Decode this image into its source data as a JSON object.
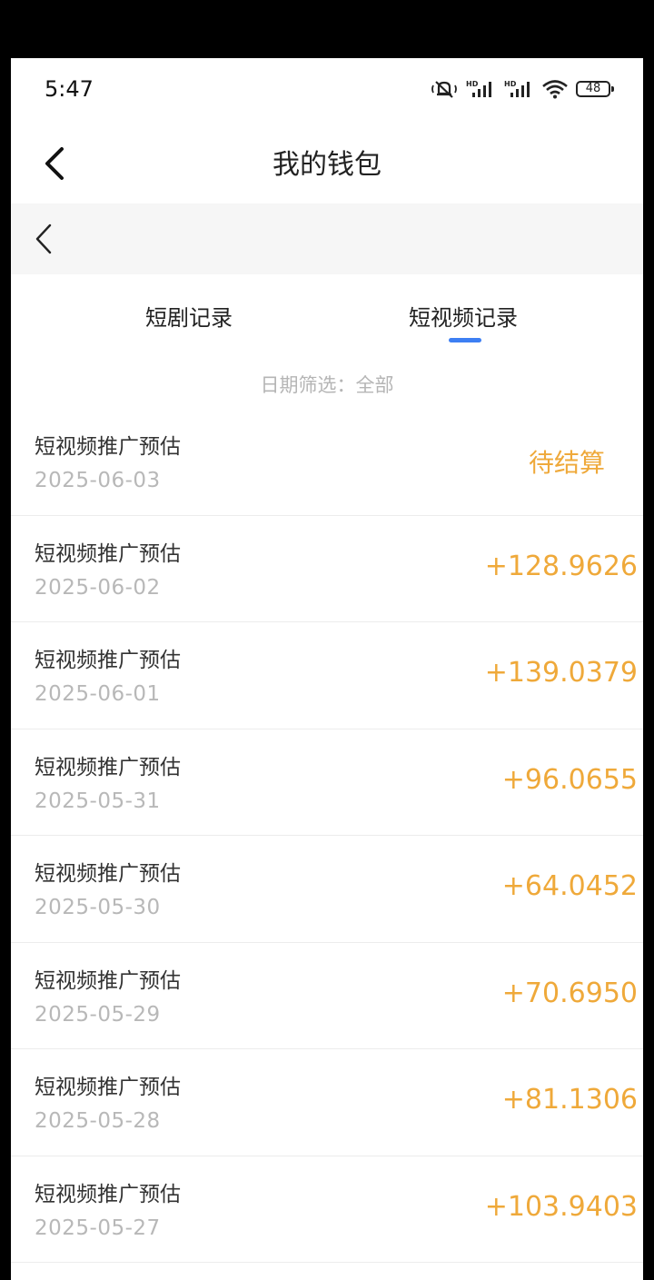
{
  "status_bar": {
    "time": "5:47",
    "battery": "48",
    "icons": [
      "mute-vibrate-icon",
      "signal-hd-icon",
      "signal-hd-icon",
      "wifi-icon",
      "battery-icon"
    ]
  },
  "header": {
    "title": "我的钱包"
  },
  "tabs": [
    {
      "label": "短剧记录",
      "active": false
    },
    {
      "label": "短视频记录",
      "active": true
    }
  ],
  "filter": {
    "label": "日期筛选：全部"
  },
  "colors": {
    "accent": "#3d7ff3",
    "amount": "#efa93a",
    "muted": "#b8b8b8"
  },
  "records": [
    {
      "title": "短视频推广预估",
      "date": "2025-06-03",
      "amount": "待结算"
    },
    {
      "title": "短视频推广预估",
      "date": "2025-06-02",
      "amount": "+128.9626"
    },
    {
      "title": "短视频推广预估",
      "date": "2025-06-01",
      "amount": "+139.0379"
    },
    {
      "title": "短视频推广预估",
      "date": "2025-05-31",
      "amount": "+96.0655"
    },
    {
      "title": "短视频推广预估",
      "date": "2025-05-30",
      "amount": "+64.0452"
    },
    {
      "title": "短视频推广预估",
      "date": "2025-05-29",
      "amount": "+70.6950"
    },
    {
      "title": "短视频推广预估",
      "date": "2025-05-28",
      "amount": "+81.1306"
    },
    {
      "title": "短视频推广预估",
      "date": "2025-05-27",
      "amount": "+103.9403"
    }
  ]
}
